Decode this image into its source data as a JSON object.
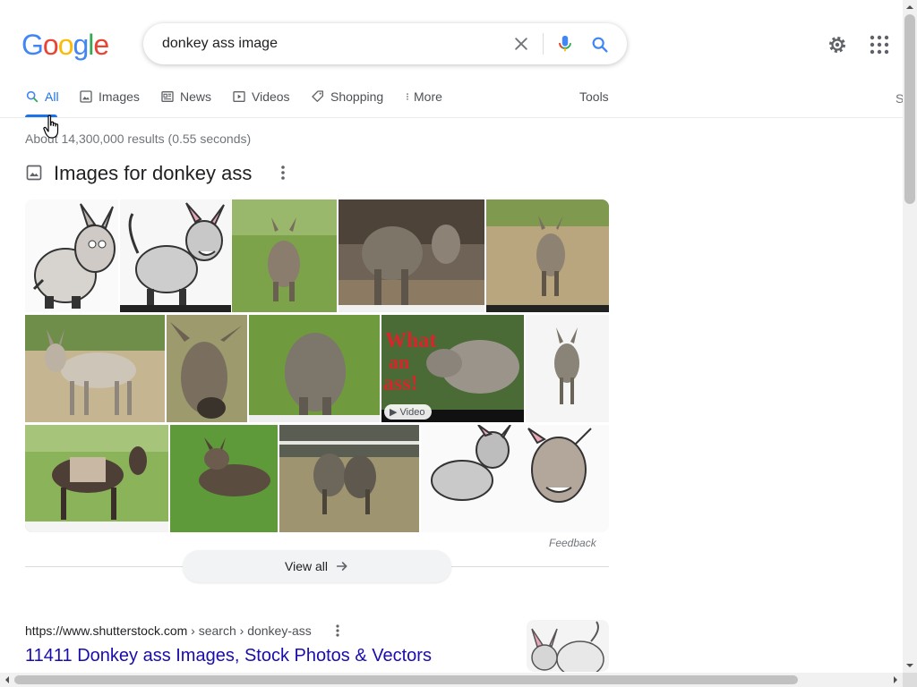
{
  "logo": {
    "text": "Google",
    "colors": [
      "#4285f4",
      "#ea4335",
      "#fbbc05",
      "#4285f4",
      "#34a853",
      "#ea4335"
    ]
  },
  "search": {
    "value": "donkey ass image"
  },
  "tabs": [
    {
      "label": "All",
      "icon": "search-icon",
      "active": true
    },
    {
      "label": "Images",
      "icon": "image-icon",
      "active": false
    },
    {
      "label": "News",
      "icon": "news-icon",
      "active": false
    },
    {
      "label": "Videos",
      "icon": "video-icon",
      "active": false
    },
    {
      "label": "Shopping",
      "icon": "tag-icon",
      "active": false
    },
    {
      "label": "More",
      "icon": "more-vert-icon",
      "active": false
    }
  ],
  "tools_label": "Tools",
  "edge_text": "S",
  "stats": "About 14,300,000 results (0.55 seconds)",
  "images_section": {
    "title": "Images for donkey ass",
    "video_badge": "Video",
    "feedback": "Feedback",
    "view_all": "View all"
  },
  "result": {
    "url": "https://www.shutterstock.com",
    "breadcrumb": " › search › donkey-ass",
    "title": "11411 Donkey ass Images, Stock Photos & Vectors"
  },
  "colors": {
    "accent": "#1a73e8",
    "link": "#1a0dab"
  }
}
